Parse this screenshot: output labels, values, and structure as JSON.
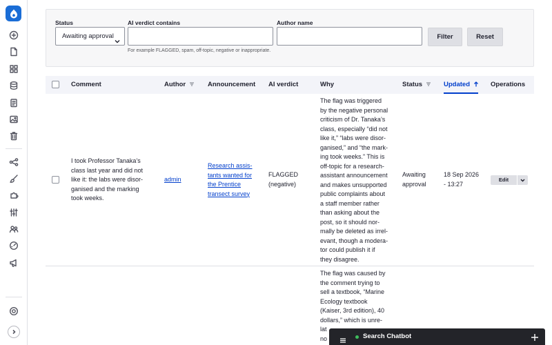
{
  "toolbar": {
    "icons": [
      "add-icon",
      "content-icon",
      "structure-icon",
      "database-icon",
      "files-icon",
      "media-icon",
      "trash-icon",
      "workflow-icon",
      "appearance-icon",
      "extend-icon",
      "configuration-icon",
      "people-icon",
      "reports-icon",
      "announcements-icon",
      "help-icon",
      "expand-icon"
    ]
  },
  "filters": {
    "status_label": "Status",
    "status_value": "Awaiting approval",
    "verdict_label": "AI verdict contains",
    "verdict_value": "",
    "verdict_help": "For example FLAGGED, spam, off-topic, negative or inappropriate.",
    "author_label": "Author name",
    "author_value": "",
    "filter_button": "Filter",
    "reset_button": "Reset"
  },
  "table": {
    "headers": {
      "comment": "Comment",
      "author": "Author",
      "announcement": "Announcement",
      "verdict": "AI verdict",
      "why": "Why",
      "status": "Status",
      "updated": "Updated",
      "operations": "Operations"
    },
    "rows": [
      {
        "comment": [
          "I took Professor Tanaka’s",
          "class last year and did not",
          "like it: the labs were disor-",
          "ganised and the marking",
          "took weeks."
        ],
        "author": "admin",
        "announcement": [
          "Research assis-",
          "tants wanted for",
          "the Prentice",
          "transect survey"
        ],
        "verdict": [
          "FLAGGED",
          "(negative)"
        ],
        "why": [
          "The flag was triggered",
          "by the negative personal",
          "criticism of Dr. Tanaka’s",
          "class, especially “did not",
          "like it,” “labs were disor-",
          "ganised,” and “the mark-",
          "ing took weeks.” This is",
          "off-topic for a research-",
          "assistant announcement",
          "and makes unsupported",
          "public complaints about",
          "a staff member rather",
          "than asking about the",
          "post, so it should nor-",
          "mally be deleted as irrel-",
          "evant, though a modera-",
          "tor could publish it if",
          "they disagree."
        ],
        "status": [
          "Awaiting",
          "approval"
        ],
        "updated": [
          "18 Sep 2026",
          "- 13:27"
        ],
        "edit": "Edit"
      },
      {
        "why": [
          "The flag was caused by",
          "the comment trying to",
          "sell a textbook, “Marine",
          "Ecology textbook",
          "(Kaiser, 3rd edition), 40",
          "dollars,” which is unre-",
          "lat",
          "no"
        ]
      }
    ]
  },
  "chatbot": {
    "title": "Search Chatbot"
  }
}
